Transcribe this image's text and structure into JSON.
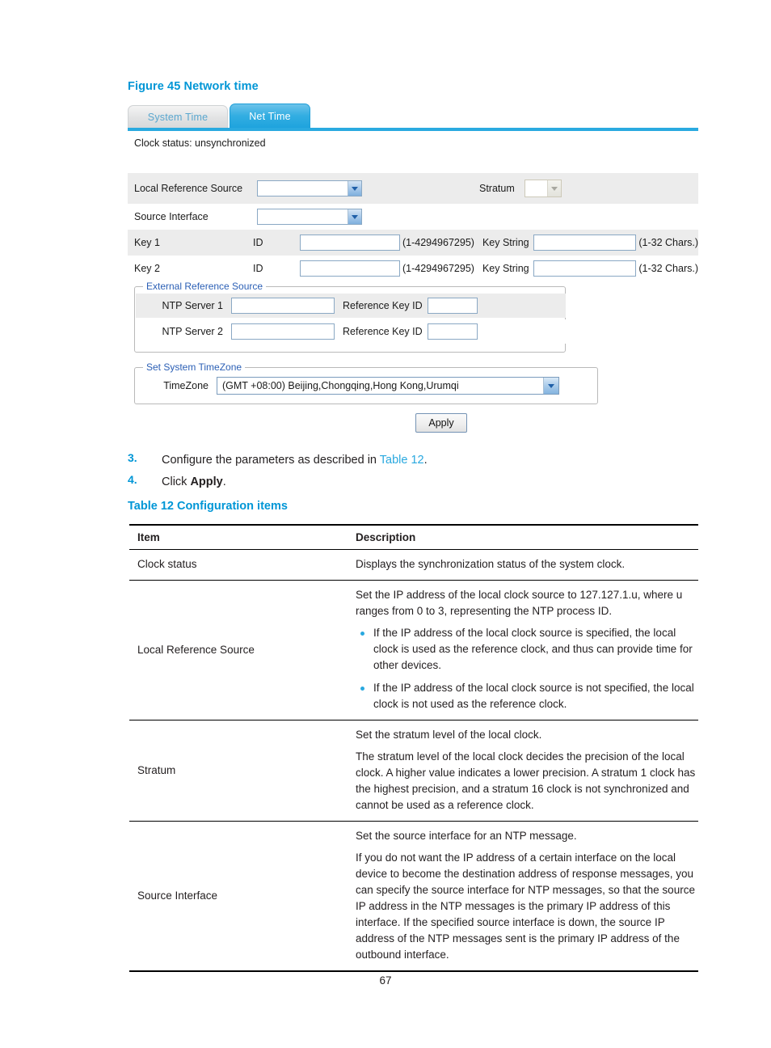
{
  "figure": {
    "caption": "Figure 45 Network time"
  },
  "webui": {
    "tabs": [
      {
        "label": "System Time",
        "active": false
      },
      {
        "label": "Net Time",
        "active": true
      }
    ],
    "clock_status": "Clock status: unsynchronized",
    "form": {
      "local_reference_source_label": "Local Reference Source",
      "local_reference_source_value": "",
      "stratum_label": "Stratum",
      "stratum_value": "",
      "source_interface_label": "Source Interface",
      "source_interface_value": "",
      "key1_label": "Key 1",
      "key2_label": "Key 2",
      "id_label": "ID",
      "key_id_hint": "(1-4294967295)",
      "key_string_label": "Key String",
      "key_string_hint": "(1-32 Chars.)",
      "key1_id_value": "",
      "key1_string_value": "",
      "key2_id_value": "",
      "key2_string_value": ""
    },
    "external_reference_source": {
      "legend": "External Reference Source",
      "rows": [
        {
          "server_label": "NTP Server 1",
          "server_value": "",
          "refkey_label": "Reference Key ID",
          "refkey_value": ""
        },
        {
          "server_label": "NTP Server 2",
          "server_value": "",
          "refkey_label": "Reference Key ID",
          "refkey_value": ""
        }
      ]
    },
    "timezone_section": {
      "legend": "Set System TimeZone",
      "label": "TimeZone",
      "value": "(GMT +08:00) Beijing,Chongqing,Hong Kong,Urumqi"
    },
    "apply_button": "Apply"
  },
  "steps": [
    {
      "number": "3.",
      "text_before": "Configure the parameters as described in ",
      "link": "Table 12",
      "text_after": "."
    },
    {
      "number": "4.",
      "text_before": "Click ",
      "bold": "Apply",
      "text_after": "."
    }
  ],
  "table": {
    "caption": "Table 12 Configuration items",
    "headers": [
      "Item",
      "Description"
    ],
    "rows": [
      {
        "item": "Clock status",
        "paragraphs": [
          "Displays the synchronization status of the system clock."
        ],
        "bullets": []
      },
      {
        "item": "Local Reference Source",
        "paragraphs": [
          "Set the IP address of the local clock source to 127.127.1.u, where u ranges from 0 to 3, representing the NTP process ID."
        ],
        "bullets": [
          "If the IP address of the local clock source is specified, the local clock is used as the reference clock, and thus can provide time for other devices.",
          "If the IP address of the local clock source is not specified, the local clock is not used as the reference clock."
        ]
      },
      {
        "item": "Stratum",
        "paragraphs": [
          "Set the stratum level of the local clock.",
          "The stratum level of the local clock decides the precision of the local clock. A higher value indicates a lower precision. A stratum 1 clock has the highest precision, and a stratum 16 clock is not synchronized and cannot be used as a reference clock."
        ],
        "bullets": []
      },
      {
        "item": "Source Interface",
        "paragraphs": [
          "Set the source interface for an NTP message.",
          "If you do not want the IP address of a certain interface on the local device to become the destination address of response messages, you can specify the source interface for NTP messages, so that the source IP address in the NTP messages is the primary IP address of this interface. If the specified source interface is down, the source IP address of the NTP messages sent is the primary IP address of the outbound interface."
        ],
        "bullets": []
      }
    ]
  },
  "footer": {
    "page_number": "67"
  }
}
